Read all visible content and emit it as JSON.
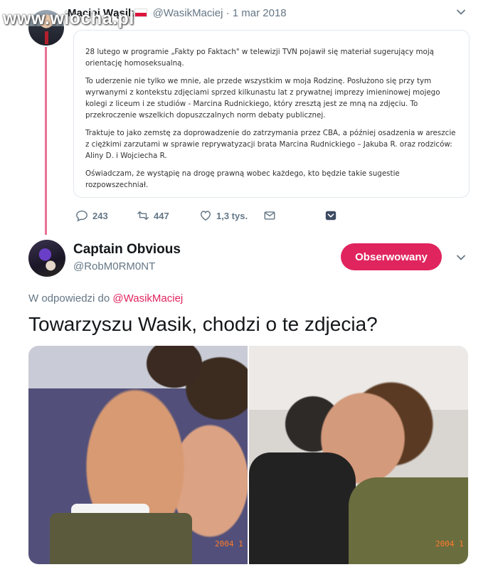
{
  "watermark": "www.wiocha.pl",
  "original_tweet": {
    "author_name": "Maciej Wąsik",
    "handle": "@WasikMaciej",
    "separator": "·",
    "date": "1 mar 2018",
    "statement_paragraphs": [
      "28 lutego w programie „Fakty po Faktach\" w telewizji TVN pojawił się materiał sugerujący moją orientację homoseksualną.",
      "To uderzenie nie tylko we mnie, ale przede wszystkim w moja Rodzinę. Posłużono się przy tym wyrwanymi z kontekstu zdjęciami sprzed kilkunastu lat z prywatnej imprezy imieninowej mojego kolegi z liceum i ze studiów -  Marcina Rudnickiego, który zresztą jest ze mną na zdjęciu. To przekroczenie wszelkich dopuszczalnych norm debaty publicznej.",
      "Traktuje to jako zemstę za doprowadzenie do zatrzymania przez CBA, a później osadzenia w areszcie z ciężkimi zarzutami w sprawie reprywatyzacji brata Marcina Rudnickiego – Jakuba R.  oraz rodziców: Aliny D. i Wojciecha R.",
      "Oświadczam, że wystąpię na drogę prawną wobec każdego, kto będzie takie sugestie rozpowszechniał."
    ],
    "actions": {
      "replies": "243",
      "retweets": "447",
      "likes": "1,3 tys."
    }
  },
  "reply": {
    "author_name": "Captain Obvious",
    "handle": "@RobM0RM0NT",
    "follow_label": "Obserwowany",
    "in_reply_prefix": "W odpowiedzi do",
    "in_reply_mention": "@WasikMaciej",
    "text": "Towarzyszu Wasik, chodzi o te zdjecia?",
    "photo_stamps": [
      "2004 1",
      "2004 1"
    ]
  },
  "colors": {
    "accent": "#e0245e",
    "muted": "#657786",
    "border": "#e1e8ed"
  },
  "icons": [
    "chevron-down-icon",
    "reply-icon",
    "retweet-icon",
    "like-icon",
    "message-icon",
    "save-icon"
  ]
}
